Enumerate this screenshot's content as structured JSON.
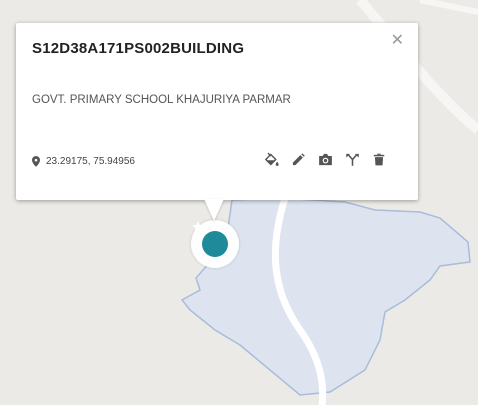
{
  "popup": {
    "title": "S12D38A171PS002BUILDING",
    "subtitle": "GOVT. PRIMARY SCHOOL KHAJURIYA PARMAR",
    "coordinates": "23.29175, 75.94956",
    "close_symbol": "✕",
    "tools": [
      {
        "name": "fill-style-icon"
      },
      {
        "name": "edit-icon"
      },
      {
        "name": "camera-icon"
      },
      {
        "name": "split-icon"
      },
      {
        "name": "delete-icon"
      }
    ]
  },
  "marker": {
    "icon": "star-icon",
    "color": "#1f8a9a"
  },
  "colors": {
    "map_background": "#eceae6",
    "polygon_fill": "#dde4ef",
    "polygon_stroke": "#a9bcd9",
    "road": "#ffffff",
    "icon_gray": "#555555"
  }
}
